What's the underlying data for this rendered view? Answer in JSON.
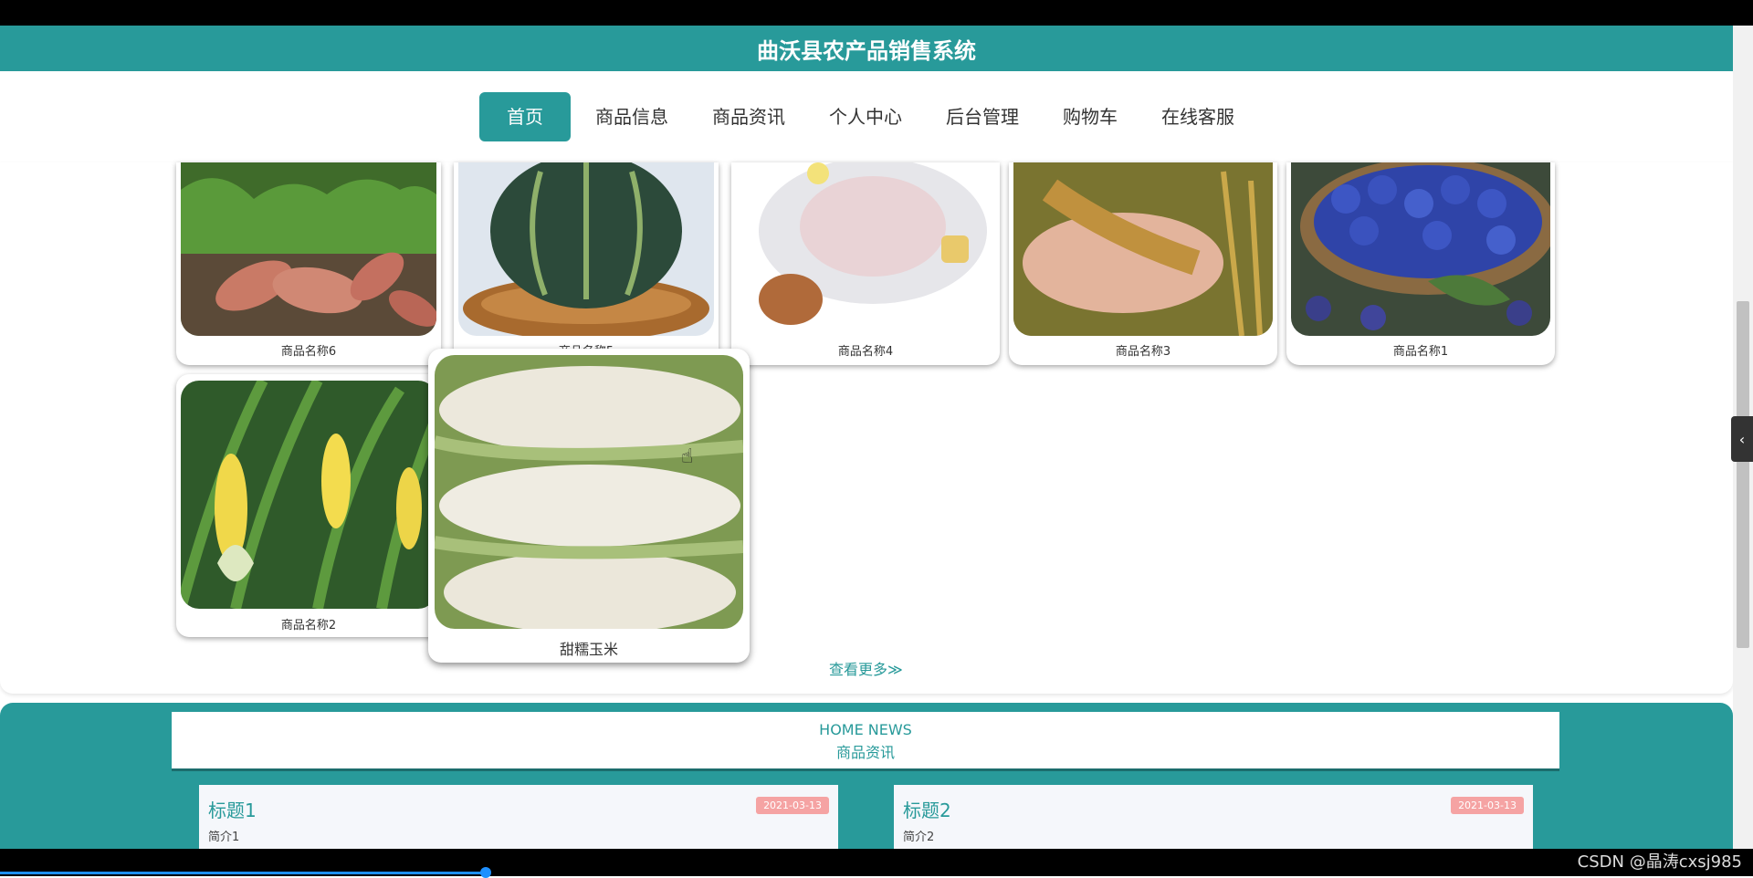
{
  "app": {
    "title": "曲沃县农产品销售系统"
  },
  "nav": {
    "items": [
      {
        "label": "首页"
      },
      {
        "label": "商品信息"
      },
      {
        "label": "商品资讯"
      },
      {
        "label": "个人中心"
      },
      {
        "label": "后台管理"
      },
      {
        "label": "购物车"
      },
      {
        "label": "在线客服"
      }
    ],
    "active_index": 0
  },
  "products": {
    "row1": [
      {
        "name": "商品名称6",
        "icon": "sweet-potato-image"
      },
      {
        "name": "商品名称5",
        "icon": "pumpkin-image"
      },
      {
        "name": "商品名称4",
        "icon": "chicken-image"
      },
      {
        "name": "商品名称3",
        "icon": "rice-image"
      },
      {
        "name": "商品名称1",
        "icon": "plum-image"
      }
    ],
    "row2": [
      {
        "name": "商品名称2",
        "icon": "corn-field-image"
      },
      {
        "name": "甜糯玉米",
        "icon": "white-corn-image"
      }
    ],
    "more_label": "查看更多≫"
  },
  "news": {
    "title_en": "HOME NEWS",
    "title_cn": "商品资讯",
    "items": [
      {
        "title": "标题1",
        "date": "2021-03-13",
        "summary": "简介1"
      },
      {
        "title": "标题2",
        "date": "2021-03-13",
        "summary": "简介2"
      }
    ]
  },
  "watermark": "CSDN @晶涛cxsj985",
  "colors": {
    "primary": "#289a9a",
    "badge": "#f5a3a3"
  }
}
